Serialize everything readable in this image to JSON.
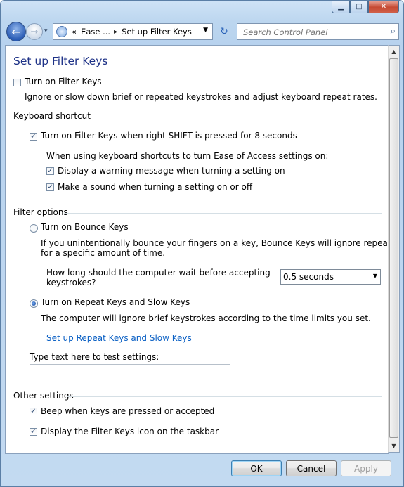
{
  "window": {
    "minimize_glyph": "▁",
    "maximize_glyph": "□",
    "close_glyph": "✕"
  },
  "navbar": {
    "back_glyph": "←",
    "forward_glyph": "→",
    "history_glyph": "▾",
    "breadcrumb_sep": "«",
    "breadcrumb_1": "Ease ...",
    "breadcrumb_arrow": "▸",
    "breadcrumb_2": "Set up Filter Keys",
    "dropdown_glyph": "▼",
    "refresh_glyph": "↻",
    "search_placeholder": "Search Control Panel",
    "search_glyph": "⌕"
  },
  "page": {
    "title": "Set up Filter Keys",
    "turn_on_filter_keys": {
      "label": "Turn on Filter Keys",
      "checked": false
    },
    "intro": "Ignore or slow down brief or repeated keystrokes and adjust keyboard repeat rates.",
    "keyboard_shortcut": {
      "heading": "Keyboard shortcut",
      "right_shift": {
        "label": "Turn on Filter Keys when right SHIFT is pressed for 8 seconds",
        "checked": true
      },
      "subtext": "When using keyboard shortcuts to turn Ease of Access settings on:",
      "warning": {
        "label": "Display a warning message when turning a setting on",
        "checked": true
      },
      "sound": {
        "label": "Make a sound when turning a setting on or off",
        "checked": true
      }
    },
    "filter_options": {
      "heading": "Filter options",
      "bounce_keys": {
        "label": "Turn on Bounce Keys",
        "selected": false
      },
      "bounce_desc_1": "If you unintentionally bounce your fingers on a key, Bounce Keys will ignore repeated keystrokes",
      "bounce_desc_2": "for a specific amount of time.",
      "wait_label_1": "How long should the computer wait before accepting",
      "wait_label_2": "keystrokes?",
      "wait_value": "0.5 seconds",
      "repeat_slow_keys": {
        "label": "Turn on Repeat Keys and Slow Keys",
        "selected": true
      },
      "repeat_desc": "The computer will ignore brief keystrokes according to the time limits you set.",
      "setup_link": "Set up Repeat Keys and Slow Keys",
      "test_label": "Type text here to test settings:",
      "test_value": ""
    },
    "other_settings": {
      "heading": "Other settings",
      "beep": {
        "label": "Beep when keys are pressed or accepted",
        "checked": true
      },
      "taskbar_icon": {
        "label": "Display the Filter Keys icon on the taskbar",
        "checked": true
      }
    }
  },
  "buttons": {
    "ok": "OK",
    "cancel": "Cancel",
    "apply": "Apply"
  },
  "checkmark": "✓",
  "scrollbar": {
    "up": "▲",
    "down": "▼"
  }
}
